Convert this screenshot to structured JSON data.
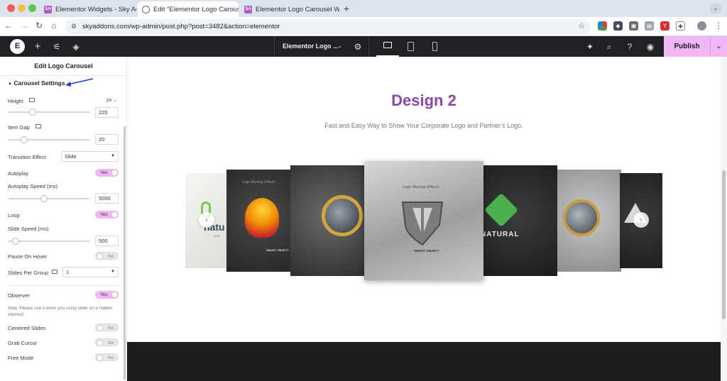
{
  "browser": {
    "tabs": [
      {
        "title": "Elementor Widgets - Sky Add",
        "favicon": "SA"
      },
      {
        "title": "Edit \"Elementor Logo Carous…",
        "favicon": ""
      },
      {
        "title": "Elementor Logo Carousel Wid…",
        "favicon": "SA"
      }
    ],
    "url": "skyaddons.com/wp-admin/post.php?post=3482&action=elementor"
  },
  "editor": {
    "doc_title": "Elementor Logo ...",
    "publish_label": "Publish"
  },
  "panel": {
    "title": "Edit Logo Carousel",
    "section": "Carousel Settings",
    "height_label": "Height",
    "height_unit": "px",
    "height_value": "220",
    "item_gap_label": "Item Gap",
    "item_gap_value": "20",
    "transition_label": "Transition Effect",
    "transition_value": "Slide",
    "autoplay_label": "Autoplay",
    "autoplay_speed_label": "Autoplay Speed (ms)",
    "autoplay_speed_value": "5000",
    "loop_label": "Loop",
    "slide_speed_label": "Slide Speed (ms)",
    "slide_speed_value": "500",
    "pause_label": "Pause On Hover",
    "slides_per_group_label": "Slides Per Group",
    "slides_per_group_value": "1",
    "observer_label": "Observer",
    "observer_note": "Note: Please use it when you using slider on a hidden element.",
    "centered_label": "Centered Slides",
    "grab_label": "Grab Cursor",
    "free_label": "Free Mode",
    "yes": "Yes",
    "no": "No"
  },
  "canvas": {
    "heading": "Design 2",
    "subheading": "Fast and Easy Way to Show Your Corporate Logo and Partner’s Logo.",
    "card_text": {
      "natural": "NATURAL",
      "natural_short": "natu",
      "natural_sub": "LIVE",
      "smart_object": "SMART OBJECT",
      "logo_mockup": "Logo Mockup Effects"
    }
  },
  "colors": {
    "accent": "#8c46a8",
    "publish": "#f0b6f5",
    "dark": "#1f2124"
  }
}
